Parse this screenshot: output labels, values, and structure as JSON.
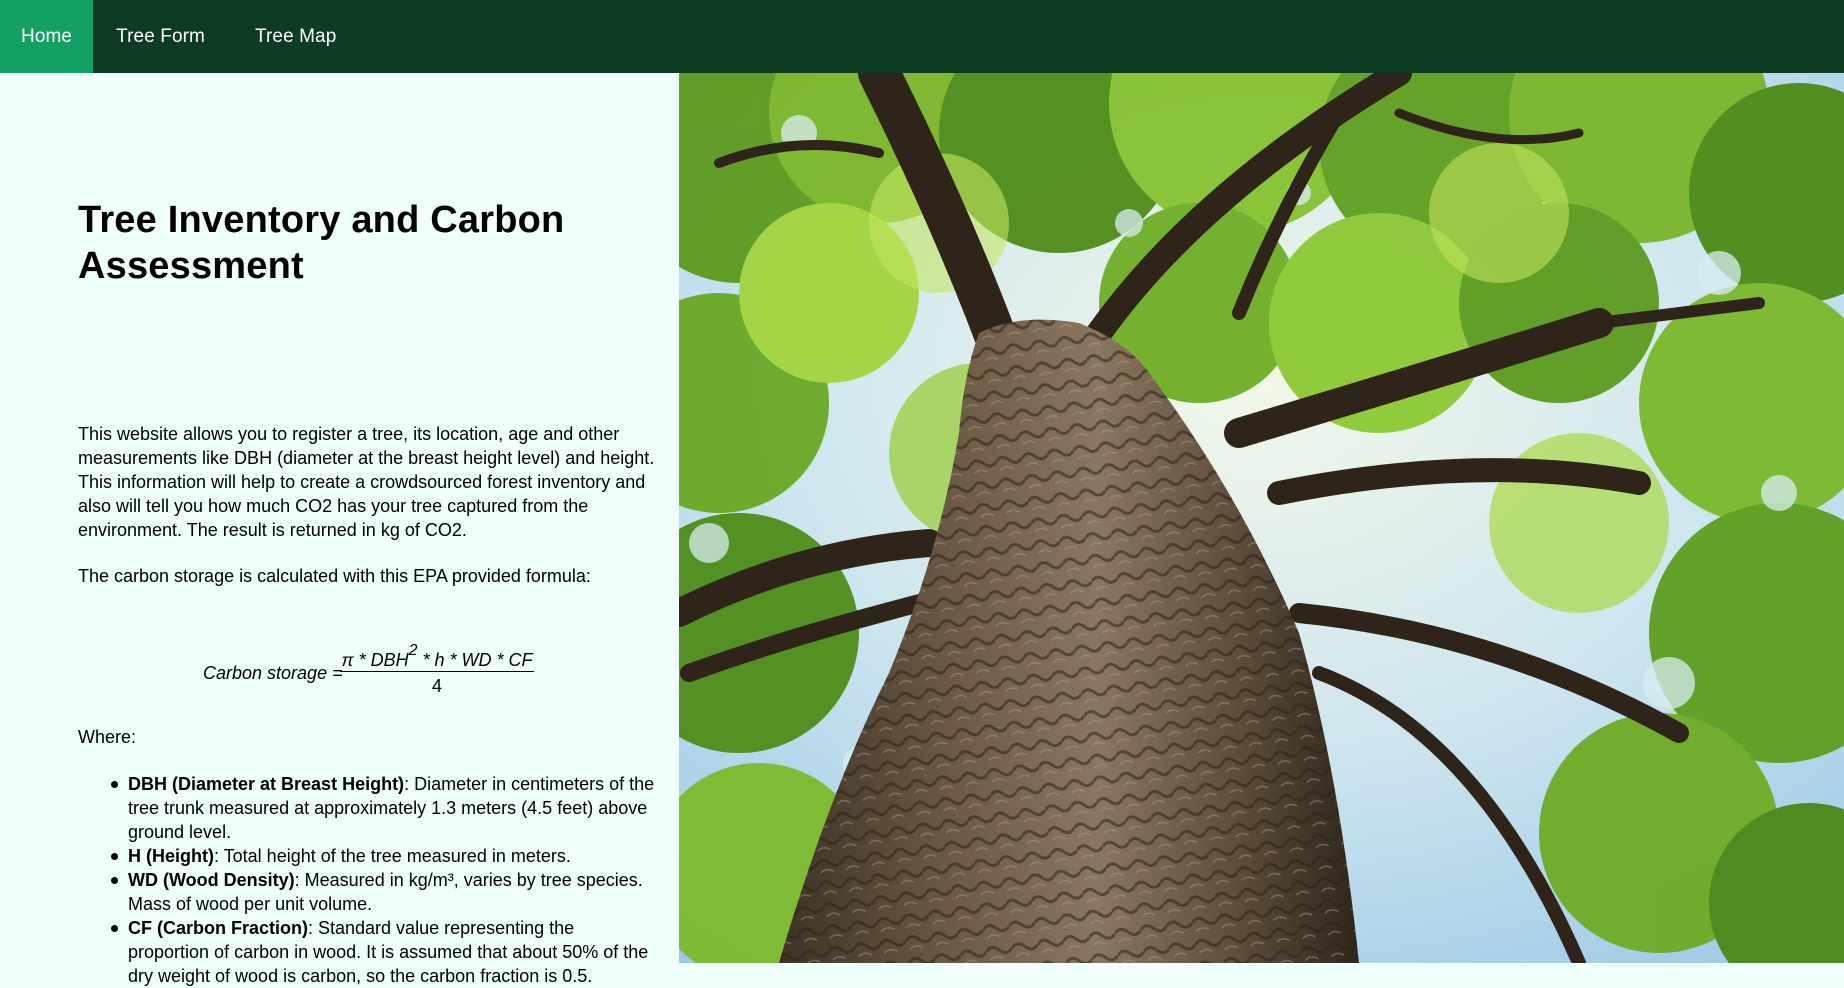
{
  "nav": {
    "items": [
      {
        "label": "Home",
        "active": true
      },
      {
        "label": "Tree Form",
        "active": false
      },
      {
        "label": "Tree Map",
        "active": false
      }
    ]
  },
  "main": {
    "title": "Tree Inventory and Carbon Assessment",
    "intro": "This website allows you to register a tree, its location, age and other measurements like DBH (diameter at the breast height level) and height. This information will help to create a crowdsourced forest inventory and also will tell you how much CO2 has your tree captured from the environment. The result is returned in kg of CO2.",
    "formula_intro": "The carbon storage is calculated with this EPA provided formula:",
    "formula": {
      "lhs": "Carbon storage =",
      "numerator_pre": "π * DBH",
      "numerator_exp": "2",
      "numerator_post": " * h * WD * CF",
      "denominator": "4"
    },
    "where_label": "Where:",
    "definitions": [
      {
        "term": "DBH (Diameter at Breast Height)",
        "text": ": Diameter in centimeters of the tree trunk measured at approximately 1.3 meters (4.5 feet) above ground level."
      },
      {
        "term": "H (Height)",
        "text": ": Total height of the tree measured in meters."
      },
      {
        "term": "WD (Wood Density)",
        "text": ": Measured in kg/m³, varies by tree species. Mass of wood per unit volume."
      },
      {
        "term": "CF (Carbon Fraction)",
        "text": ": Standard value representing the proportion of carbon in wood. It is assumed that about 50% of the dry weight of wood is carbon, so the carbon fraction is 0.5."
      }
    ]
  },
  "colors": {
    "nav_bg": "#0d3c23",
    "nav_active": "#12a163",
    "page_bg": "#effffc"
  },
  "hero_image": {
    "icon": "tree-canopy-photo"
  }
}
